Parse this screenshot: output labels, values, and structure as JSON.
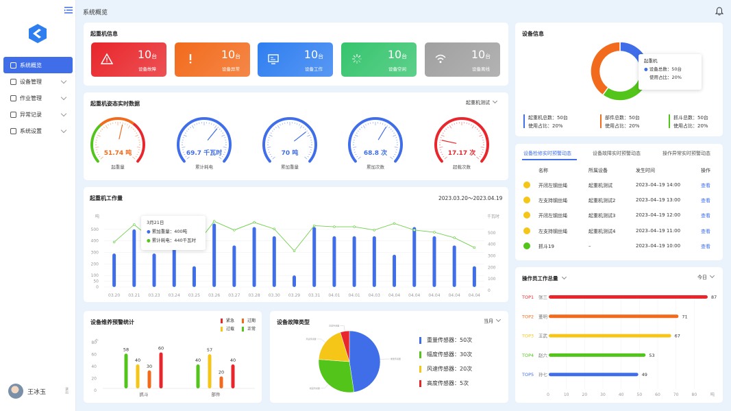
{
  "sidebar": {
    "items": [
      {
        "label": "系统概览",
        "icon": "overview-icon",
        "active": true
      },
      {
        "label": "设备管理",
        "icon": "device-icon"
      },
      {
        "label": "作业管理",
        "icon": "layers-icon"
      },
      {
        "label": "异常记录",
        "icon": "record-icon"
      },
      {
        "label": "系统设置",
        "icon": "gear-icon"
      }
    ],
    "user": {
      "name": "王冰玉",
      "logout": "退出"
    }
  },
  "header": {
    "title": "系统概览"
  },
  "crane_info": {
    "title": "起重机信息",
    "tiles": [
      {
        "num": "10",
        "unit": "台",
        "label": "设备故障",
        "icon": "warning-triangle-icon",
        "color": "#e8262b"
      },
      {
        "num": "10",
        "unit": "台",
        "label": "设备异常",
        "icon": "exclamation-icon",
        "color": "#f26a1b"
      },
      {
        "num": "10",
        "unit": "台",
        "label": "设备工作",
        "icon": "monitor-icon",
        "color": "#2f7ef0"
      },
      {
        "num": "10",
        "unit": "台",
        "label": "设备空闲",
        "icon": "loading-icon",
        "color": "#36c46e"
      },
      {
        "num": "10",
        "unit": "台",
        "label": "设备离线",
        "icon": "wifi-icon",
        "color": "#a0a0a0"
      }
    ]
  },
  "posture": {
    "title": "起重机姿态实时数据",
    "dropdown": "起重机测试",
    "gauges": [
      {
        "value": "51.74 吨",
        "label": "起重量",
        "type": "multi",
        "level": 0.55
      },
      {
        "value": "69.7 千瓦时",
        "label": "累计耗电",
        "type": "blue",
        "level": 0.65
      },
      {
        "value": "70 吨",
        "label": "累加重量",
        "type": "blue",
        "level": 0.7
      },
      {
        "value": "68.8 次",
        "label": "累加次数",
        "type": "blue",
        "level": 0.62
      },
      {
        "value": "17.17 次",
        "label": "超载次数",
        "type": "red",
        "level": 0.2
      }
    ]
  },
  "workload": {
    "title": "起重机工作量",
    "date_range": "2023.03.20～2023.04.19",
    "tooltip": {
      "date": "3月21日",
      "line1": "累加重量：400吨",
      "line2": "累计耗电：440千瓦时"
    }
  },
  "maintenance": {
    "title": "设备维养预警统计",
    "legend": [
      {
        "label": "紧急",
        "color": "#e8262b"
      },
      {
        "label": "过期",
        "color": "#f26a1b"
      },
      {
        "label": "过载",
        "color": "#f5c518"
      },
      {
        "label": "正常",
        "color": "#52c41a"
      }
    ]
  },
  "fault_type": {
    "title": "设备故障类型",
    "dropdown": "当月",
    "items": [
      {
        "label": "重量传感器：50次",
        "color": "#3f6ee8"
      },
      {
        "label": "幅度传感器：30次",
        "color": "#52c41a"
      },
      {
        "label": "风速传感器：20次",
        "color": "#f5c518"
      },
      {
        "label": "高度传感器：5次",
        "color": "#e8262b"
      }
    ]
  },
  "device_info": {
    "title": "设备信息",
    "tooltip": {
      "title": "起重机",
      "line1": "设备总数：50台",
      "line2": "使用占比：20%"
    },
    "stats": [
      {
        "line1": "起重机总数：50台",
        "line2": "使用占比：20%",
        "color": "#3f6ee8"
      },
      {
        "line1": "部件总数：50台",
        "line2": "使用占比：20%",
        "color": "#f26a1b"
      },
      {
        "line1": "抓斗总数：50台",
        "line2": "使用占比：20%",
        "color": "#52c41a"
      }
    ]
  },
  "alerts": {
    "tabs": [
      "设备检修实时预警动态",
      "设备故障实时预警动态",
      "操作异常实时预警动态"
    ],
    "headers": [
      "名称",
      "所属设备",
      "发生时间",
      "操作"
    ],
    "rows": [
      {
        "name": "开闭左钢丝绳",
        "device": "起重机测试",
        "time": "2023–04–19 14:00",
        "action": "查看",
        "icon_color": "#f5c518"
      },
      {
        "name": "左支持钢丝绳",
        "device": "起重机测试2",
        "time": "2023–04–19 13:00",
        "action": "查看",
        "icon_color": "#f5c518"
      },
      {
        "name": "开闭左钢丝绳",
        "device": "起重机测试3",
        "time": "2023–04–19 12:00",
        "action": "查看",
        "icon_color": "#f5c518"
      },
      {
        "name": "左支持钢丝绳",
        "device": "起重机测试4",
        "time": "2023–04–19 11:00",
        "action": "查看",
        "icon_color": "#f5c518"
      },
      {
        "name": "抓斗19",
        "device": "–",
        "time": "2023–04–19 10:00",
        "action": "查看",
        "icon_color": "#52c41a"
      }
    ]
  },
  "operators": {
    "title": "操作员工作总量",
    "dropdown": "今日"
  },
  "chart_data": [
    {
      "type": "bar",
      "title": "起重机工作量",
      "categories": [
        "03.20",
        "03.21",
        "03.23",
        "03.24",
        "03.25",
        "03.26",
        "03.27",
        "03.28",
        "03.30",
        "03.29",
        "03.31",
        "04.01",
        "04.01",
        "04.03",
        "04.04",
        "04.04",
        "04.04",
        "04.04",
        "04.04"
      ],
      "series": [
        {
          "name": "累加重量",
          "type": "bar",
          "unit": "吨",
          "values": [
            290,
            500,
            290,
            400,
            180,
            550,
            360,
            520,
            440,
            100,
            520,
            440,
            440,
            440,
            280,
            520,
            440,
            360,
            180
          ]
        },
        {
          "name": "累计耗电",
          "type": "line",
          "unit": "千瓦时",
          "values": [
            410,
            570,
            420,
            410,
            360,
            600,
            520,
            590,
            530,
            330,
            560,
            550,
            550,
            520,
            580,
            520,
            500,
            450,
            360
          ]
        }
      ],
      "ylabel_left": "吨",
      "ylabel_right": "千瓦时",
      "ylim_left": [
        0,
        600
      ],
      "ylim_right": [
        0,
        600
      ],
      "yticks_left": [
        0,
        50,
        100,
        200,
        300,
        400,
        500
      ],
      "yticks_right": [
        0,
        100,
        200,
        300,
        400,
        500
      ]
    },
    {
      "type": "bar",
      "title": "设备维养预警统计",
      "categories": [
        "抓斗",
        "部件"
      ],
      "ylabel": "个",
      "ylim": [
        0,
        80
      ],
      "yticks": [
        0,
        20,
        40,
        60,
        80
      ],
      "series": [
        {
          "name": "正常",
          "values": [
            58,
            40
          ]
        },
        {
          "name": "过载",
          "values": [
            40,
            57
          ]
        },
        {
          "name": "过期",
          "values": [
            30,
            20
          ]
        },
        {
          "name": "紧急",
          "values": [
            60,
            40
          ]
        }
      ]
    },
    {
      "type": "pie",
      "title": "设备故障类型",
      "categories": [
        "重量传感器",
        "幅度传感器",
        "风速传感器",
        "高度传感器"
      ],
      "values": [
        50,
        30,
        20,
        5
      ]
    },
    {
      "type": "pie",
      "title": "设备信息",
      "categories": [
        "起重机",
        "部件",
        "抓斗"
      ],
      "values": [
        20,
        40,
        40
      ]
    },
    {
      "type": "bar",
      "title": "操作员工作总量",
      "orientation": "horizontal",
      "categories": [
        {
          "rank": "TOP1",
          "name": "张三",
          "color": "#e8262b"
        },
        {
          "rank": "TOP2",
          "name": "董明",
          "color": "#f26a1b"
        },
        {
          "rank": "TOP3",
          "name": "王武",
          "color": "#f5c518"
        },
        {
          "rank": "TOP4",
          "name": "赵六",
          "color": "#52c41a"
        },
        {
          "rank": "TOP5",
          "name": "孙七",
          "color": "#3f6ee8"
        }
      ],
      "values": [
        87,
        71,
        67,
        53,
        49
      ],
      "xlim": [
        0,
        90
      ],
      "xticks": [
        0,
        10,
        20,
        30,
        40,
        50,
        60,
        70,
        80
      ],
      "xunit": "吨"
    }
  ]
}
